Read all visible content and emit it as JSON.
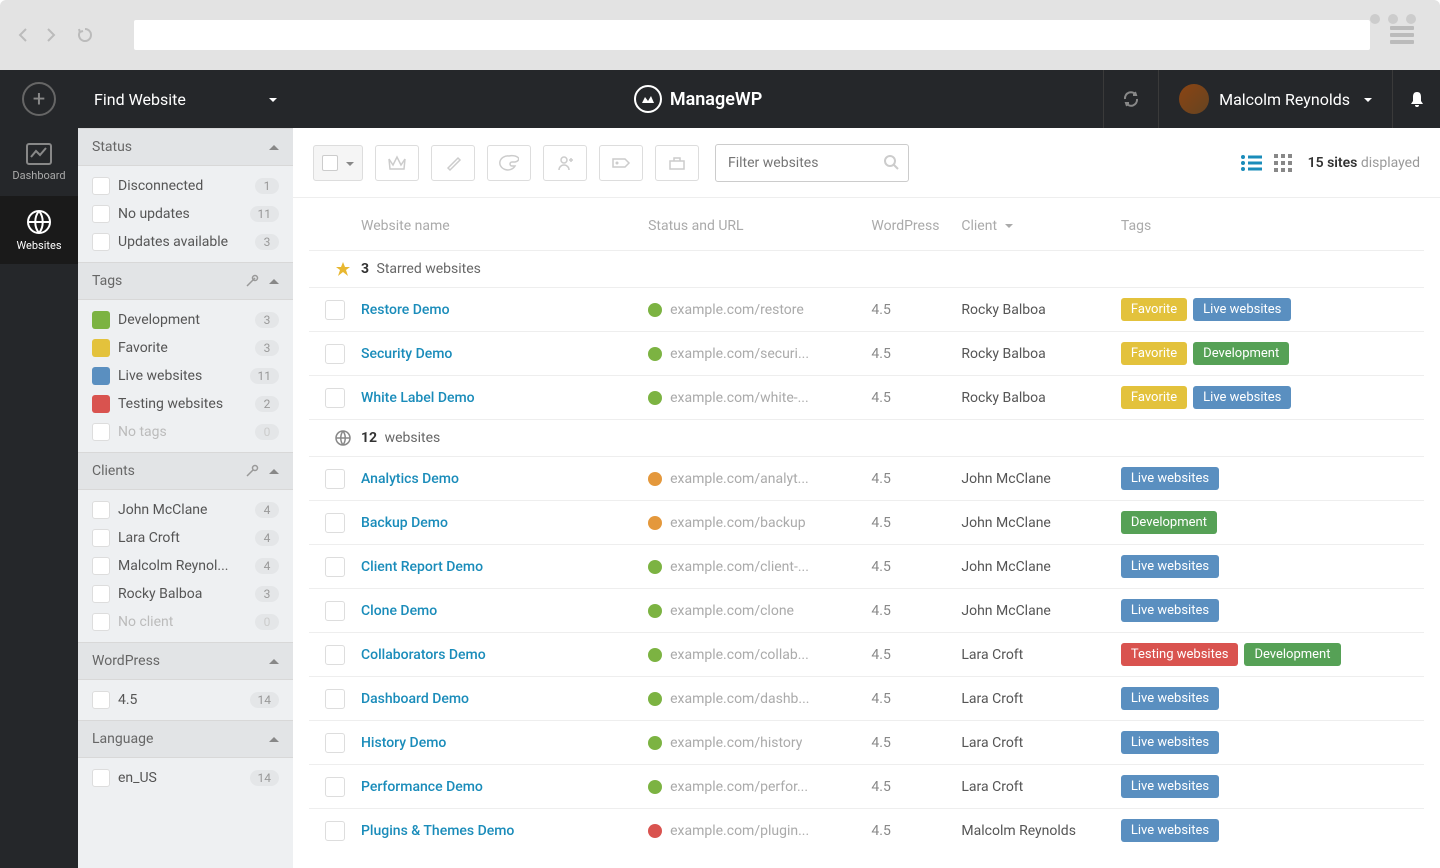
{
  "header": {
    "find_website": "Find Website",
    "logo_text": "ManageWP",
    "user_name": "Malcolm Reynolds"
  },
  "rail": {
    "dashboard": "Dashboard",
    "websites": "Websites"
  },
  "filters": {
    "status": {
      "title": "Status",
      "items": [
        {
          "label": "Disconnected",
          "count": "1"
        },
        {
          "label": "No updates",
          "count": "11"
        },
        {
          "label": "Updates available",
          "count": "3"
        }
      ]
    },
    "tags": {
      "title": "Tags",
      "items": [
        {
          "label": "Development",
          "count": "3",
          "color": "#7cb342"
        },
        {
          "label": "Favorite",
          "count": "3",
          "color": "#e3c23c"
        },
        {
          "label": "Live websites",
          "count": "11",
          "color": "#5a8fc0"
        },
        {
          "label": "Testing websites",
          "count": "2",
          "color": "#d9534f"
        },
        {
          "label": "No tags",
          "count": "0",
          "muted": true
        }
      ]
    },
    "clients": {
      "title": "Clients",
      "items": [
        {
          "label": "John McClane",
          "count": "4"
        },
        {
          "label": "Lara Croft",
          "count": "4"
        },
        {
          "label": "Malcolm Reynol...",
          "count": "4"
        },
        {
          "label": "Rocky Balboa",
          "count": "3"
        },
        {
          "label": "No client",
          "count": "0",
          "muted": true
        }
      ]
    },
    "wordpress": {
      "title": "WordPress",
      "items": [
        {
          "label": "4.5",
          "count": "14"
        }
      ]
    },
    "language": {
      "title": "Language",
      "items": [
        {
          "label": "en_US",
          "count": "14"
        }
      ]
    }
  },
  "toolbar": {
    "filter_placeholder": "Filter websites",
    "sites_count": "15 sites",
    "displayed": "displayed"
  },
  "table": {
    "headers": {
      "name": "Website name",
      "status": "Status and URL",
      "wp": "WordPress",
      "client": "Client",
      "tags": "Tags"
    },
    "starred_group": {
      "count": "3",
      "label": "Starred websites"
    },
    "websites_group": {
      "count": "12",
      "label": "websites"
    },
    "starred_rows": [
      {
        "name": "Restore Demo",
        "status": "green",
        "url": "example.com/restore",
        "wp": "4.5",
        "client": "Rocky Balboa",
        "tags": [
          {
            "label": "Favorite",
            "cls": "tag-yellow"
          },
          {
            "label": "Live websites",
            "cls": "tag-blue"
          }
        ]
      },
      {
        "name": "Security Demo",
        "status": "green",
        "url": "example.com/securi...",
        "wp": "4.5",
        "client": "Rocky Balboa",
        "tags": [
          {
            "label": "Favorite",
            "cls": "tag-yellow"
          },
          {
            "label": "Development",
            "cls": "tag-green"
          }
        ]
      },
      {
        "name": "White Label Demo",
        "status": "green",
        "url": "example.com/white-...",
        "wp": "4.5",
        "client": "Rocky Balboa",
        "tags": [
          {
            "label": "Favorite",
            "cls": "tag-yellow"
          },
          {
            "label": "Live websites",
            "cls": "tag-blue"
          }
        ]
      }
    ],
    "website_rows": [
      {
        "name": "Analytics Demo",
        "status": "orange",
        "url": "example.com/analyt...",
        "wp": "4.5",
        "client": "John McClane",
        "tags": [
          {
            "label": "Live websites",
            "cls": "tag-blue"
          }
        ]
      },
      {
        "name": "Backup Demo",
        "status": "orange",
        "url": "example.com/backup",
        "wp": "4.5",
        "client": "John McClane",
        "tags": [
          {
            "label": "Development",
            "cls": "tag-green"
          }
        ]
      },
      {
        "name": "Client Report Demo",
        "status": "green",
        "url": "example.com/client-...",
        "wp": "4.5",
        "client": "John McClane",
        "tags": [
          {
            "label": "Live websites",
            "cls": "tag-blue"
          }
        ]
      },
      {
        "name": "Clone Demo",
        "status": "green",
        "url": "example.com/clone",
        "wp": "4.5",
        "client": "John McClane",
        "tags": [
          {
            "label": "Live websites",
            "cls": "tag-blue"
          }
        ]
      },
      {
        "name": "Collaborators Demo",
        "status": "green",
        "url": "example.com/collab...",
        "wp": "4.5",
        "client": "Lara Croft",
        "tags": [
          {
            "label": "Testing websites",
            "cls": "tag-red"
          },
          {
            "label": "Development",
            "cls": "tag-green"
          }
        ]
      },
      {
        "name": "Dashboard Demo",
        "status": "green",
        "url": "example.com/dashb...",
        "wp": "4.5",
        "client": "Lara Croft",
        "tags": [
          {
            "label": "Live websites",
            "cls": "tag-blue"
          }
        ]
      },
      {
        "name": "History Demo",
        "status": "green",
        "url": "example.com/history",
        "wp": "4.5",
        "client": "Lara Croft",
        "tags": [
          {
            "label": "Live websites",
            "cls": "tag-blue"
          }
        ]
      },
      {
        "name": "Performance Demo",
        "status": "green",
        "url": "example.com/perfor...",
        "wp": "4.5",
        "client": "Lara Croft",
        "tags": [
          {
            "label": "Live websites",
            "cls": "tag-blue"
          }
        ]
      },
      {
        "name": "Plugins & Themes Demo",
        "status": "red",
        "url": "example.com/plugin...",
        "wp": "4.5",
        "client": "Malcolm Reynolds",
        "tags": [
          {
            "label": "Live websites",
            "cls": "tag-blue"
          }
        ]
      }
    ]
  }
}
